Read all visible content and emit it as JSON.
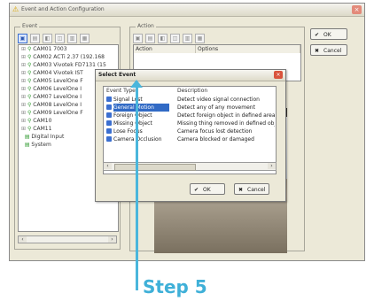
{
  "window": {
    "title": "Event and Action Configuration",
    "close_glyph": "×"
  },
  "event_panel": {
    "legend": "Event",
    "toolbar_icons": [
      "new-event-icon",
      "copy-icon",
      "edit-icon",
      "delete-icon",
      "save-icon",
      "import-icon"
    ],
    "tree": [
      {
        "expander": "⊞",
        "label": "CAM01 7003"
      },
      {
        "expander": "⊞",
        "label": "CAM02 ACTi 2.37 (192.168"
      },
      {
        "expander": "⊞",
        "label": "CAM03 Vivotek FD7131 (15"
      },
      {
        "expander": "⊞",
        "label": "CAM04 Vivotek IST"
      },
      {
        "expander": "⊞",
        "label": "CAM05 LevelOne F"
      },
      {
        "expander": "⊞",
        "label": "CAM06 LevelOne I"
      },
      {
        "expander": "⊞",
        "label": "CAM07 LevelOne I"
      },
      {
        "expander": "⊞",
        "label": "CAM08 LevelOne I"
      },
      {
        "expander": "⊞",
        "label": "CAM09 LevelOne F"
      },
      {
        "expander": "⊞",
        "label": "CAM10"
      },
      {
        "expander": "⊞",
        "label": "CAM11"
      },
      {
        "expander": "",
        "label": "Digital Input"
      },
      {
        "expander": "",
        "label": "System"
      }
    ]
  },
  "action_panel": {
    "legend": "Action",
    "columns": [
      "Action",
      "Options"
    ]
  },
  "buttons": {
    "ok": "OK",
    "cancel": "Cancel"
  },
  "dialog": {
    "title": "Select Event",
    "columns": {
      "type": "Event Type",
      "desc": "Description"
    },
    "rows": [
      {
        "type": "Signal Lost",
        "desc": "Detect video signal connection"
      },
      {
        "type": "General Motion",
        "desc": "Detect any of any movement"
      },
      {
        "type": "Foreign Object",
        "desc": "Detect foreign object in defined area"
      },
      {
        "type": "Missing Object",
        "desc": "Missing thing removed in defined object"
      },
      {
        "type": "Lose Focus",
        "desc": "Camera focus lost detection"
      },
      {
        "type": "Camera Occlusion",
        "desc": "Camera blocked or damaged"
      }
    ],
    "selected_index": 1,
    "ok": "OK",
    "cancel": "Cancel"
  },
  "annotation": {
    "label": "Step 5",
    "color": "#3fb0d8"
  }
}
